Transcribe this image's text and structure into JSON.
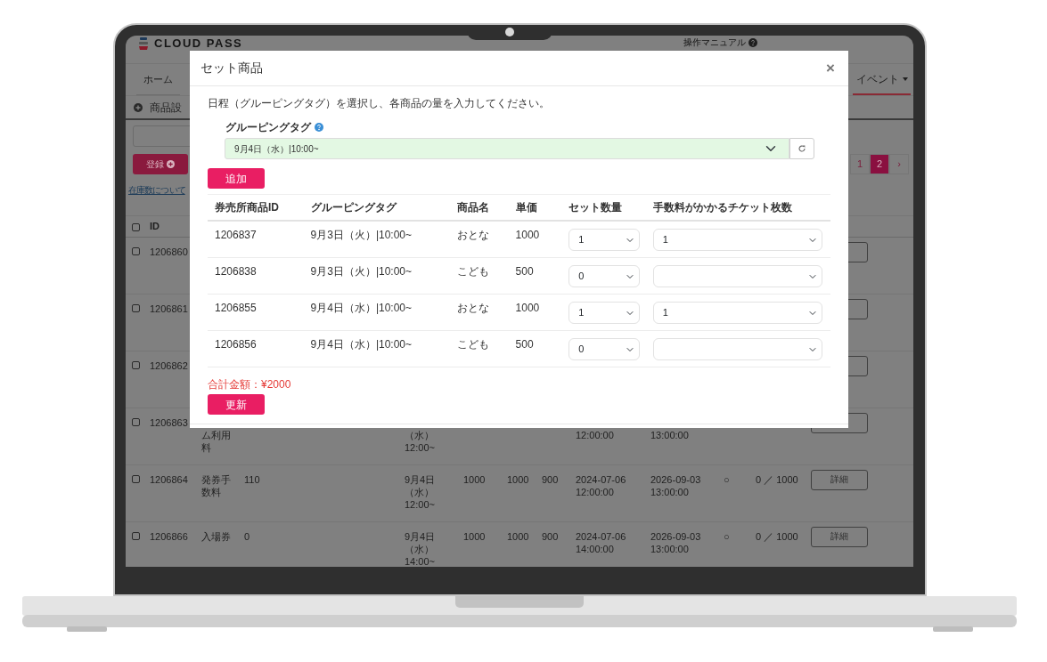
{
  "app": {
    "logo": "CLOUD PASS",
    "manual_link": "操作マニュアル",
    "nav": [
      {
        "label": "ホーム",
        "selected": false
      },
      {
        "label": "イベント",
        "selected": true
      }
    ],
    "section_title": "商品設",
    "register_button": "登録",
    "stock_link": "在庫数について",
    "pagination": [
      {
        "label": "1",
        "selected": false
      },
      {
        "label": "2",
        "selected": true
      },
      {
        "label": "›",
        "selected": false
      }
    ],
    "table": {
      "columns": [
        "ID"
      ],
      "all_checked": false,
      "rows": [
        {
          "kind": "full",
          "checked": false,
          "id": "1206860"
        },
        {
          "kind": "full",
          "checked": false,
          "id": "1206861"
        },
        {
          "kind": "full",
          "checked": false,
          "id": "1206862"
        },
        {
          "kind": "cut",
          "checked": false,
          "id": "1206863",
          "name": "ム利用料",
          "date": "（水）12:00~",
          "start": "12:00:00",
          "end": "13:00:00"
        },
        {
          "kind": "full",
          "checked": false,
          "id": "1206864",
          "name": "発券手数料",
          "col_3": "110",
          "date": "9月4日（水）12:00~",
          "col_5": "1000",
          "col_6": "1000",
          "col_7": "900",
          "start": "2024-07-06 12:00:00",
          "end": "2026-09-03 13:00:00",
          "mark": "○",
          "stock": "0 ／ 1000",
          "detail": "詳細"
        },
        {
          "kind": "full",
          "checked": false,
          "id": "1206866",
          "name": "入場券",
          "col_3": "0",
          "date": "9月4日（水）14:00~",
          "col_5": "1000",
          "col_6": "1000",
          "col_7": "900",
          "start": "2024-07-06 14:00:00",
          "end": "2026-09-03 13:00:00",
          "mark": "○",
          "stock": "0 ／ 1000",
          "detail": "詳細"
        }
      ]
    }
  },
  "modal": {
    "title": "セット商品",
    "close": "×",
    "instruction": "日程（グルーピングタグ）を選択し、各商品の量を入力してください。",
    "tag_label": "グルーピングタグ",
    "tag_select": {
      "value": "9月4日（水）|10:00~"
    },
    "add_button": "追加",
    "table": {
      "columns": [
        "券売所商品ID",
        "グルーピングタグ",
        "商品名",
        "単価",
        "セット数量",
        "手数料がかかるチケット枚数"
      ],
      "rows": [
        {
          "id": "1206837",
          "tag": "9月3日（火）|10:00~",
          "name": "おとな",
          "price": "1000",
          "set_qty": "1",
          "fee_tickets": "1"
        },
        {
          "id": "1206838",
          "tag": "9月3日（火）|10:00~",
          "name": "こども",
          "price": "500",
          "set_qty": "0"
        },
        {
          "id": "1206855",
          "tag": "9月4日（水）|10:00~",
          "name": "おとな",
          "price": "1000",
          "set_qty": "1",
          "fee_tickets": "1"
        },
        {
          "id": "1206856",
          "tag": "9月4日（水）|10:00~",
          "name": "こども",
          "price": "500",
          "set_qty": "0"
        }
      ]
    },
    "total": "合計金額：¥2000",
    "update_button": "更新"
  }
}
